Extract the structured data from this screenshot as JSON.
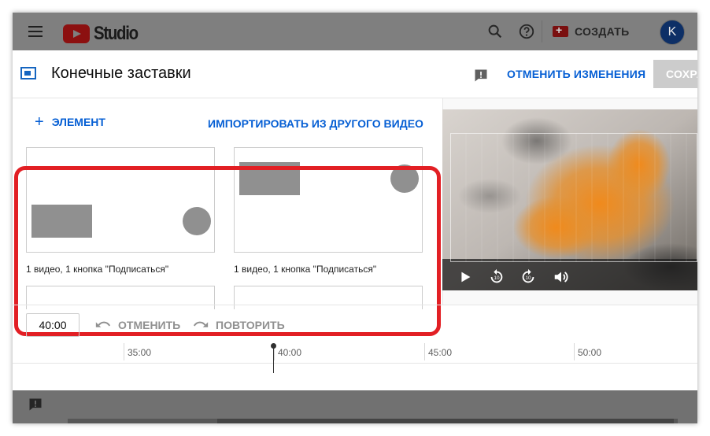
{
  "header": {
    "brand": "Studio",
    "create_label": "СОЗДАТЬ",
    "avatar_letter": "K"
  },
  "dialog": {
    "title": "Конечные заставки",
    "cancel_label": "ОТМЕНИТЬ ИЗМЕНЕНИЯ",
    "save_label": "СОХРАНИТЬ"
  },
  "elements": {
    "add_label": "ЭЛЕМЕНТ",
    "import_label": "ИМПОРТИРОВАТЬ ИЗ ДРУГОГО ВИДЕО"
  },
  "templates": [
    {
      "caption": "1 видео, 1 кнопка \"Подписаться\""
    },
    {
      "caption": "1 видео, 1 кнопка \"Подписаться\""
    }
  ],
  "timeline": {
    "time_value": "40:00",
    "undo_label": "ОТМЕНИТЬ",
    "redo_label": "ПОВТОРИТЬ",
    "ticks": [
      "35:00",
      "40:00",
      "45:00",
      "50:00"
    ]
  },
  "colors": {
    "accent": "#065fd4",
    "highlight": "#e21f24",
    "placeholder": "#909090"
  }
}
